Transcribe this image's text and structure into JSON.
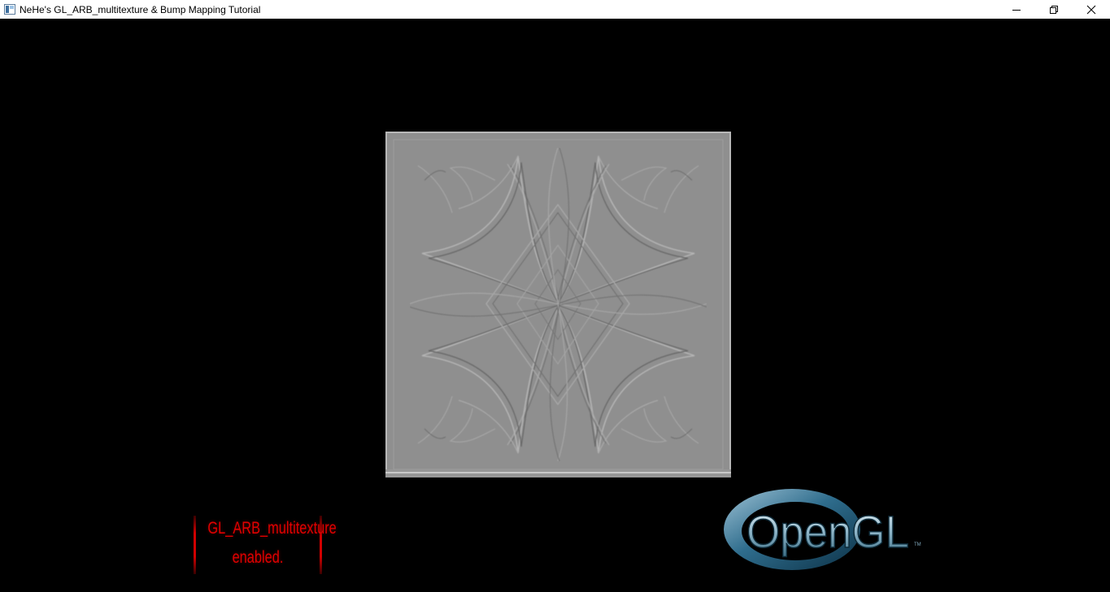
{
  "window": {
    "title": "NeHe's GL_ARB_multitexture & Bump Mapping Tutorial",
    "controls": {
      "minimize": "minimize-icon",
      "restore": "restore-icon",
      "close": "close-icon"
    }
  },
  "scene": {
    "background_color": "#000000",
    "quad_color": "#8e8e8e",
    "status_lines": [
      "GL_ARB_multitexture",
      "enabled."
    ],
    "status_color": "#e00000",
    "logo": {
      "text": "OpenGL",
      "trademark": "TM"
    }
  }
}
